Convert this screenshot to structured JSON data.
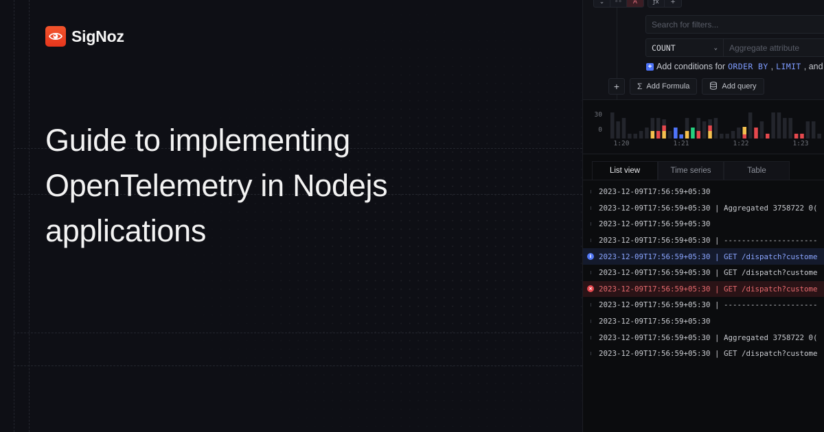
{
  "brand": {
    "name": "SigNoz",
    "accent": "#EB3F22",
    "logo_icon": "eye-icon"
  },
  "hero": {
    "title_lines": [
      "Guide to implementing",
      "OpenTelemetry in Nodejs",
      "applications"
    ]
  },
  "query_builder": {
    "toolbar_left": [
      {
        "icon": "chevron-down-icon",
        "glyph": "⌄"
      },
      {
        "icon": "visibility-icon",
        "glyph": "◦◦"
      },
      {
        "icon": "query-label",
        "glyph": "A",
        "active": true
      }
    ],
    "toolbar_right": [
      {
        "icon": "function-icon",
        "glyph": "ƒx"
      },
      {
        "icon": "plus-icon",
        "glyph": "+"
      }
    ],
    "filter_placeholder": "Search for filters...",
    "aggregate": {
      "selected": "COUNT",
      "attribute_placeholder": "Aggregate attribute"
    },
    "conditions": {
      "prefix": "Add conditions for",
      "keywords": [
        "ORDER BY",
        "LIMIT"
      ],
      "separator": ",",
      "suffix": ", and"
    },
    "actions": {
      "add": "+",
      "add_formula": "Add Formula",
      "add_query": "Add query"
    }
  },
  "chart_data": {
    "type": "bar",
    "title": "",
    "xlabel": "",
    "ylabel": "",
    "y_ticks": [
      "30",
      "0"
    ],
    "x_ticks": [
      "1:20",
      "1:21",
      "1:22",
      "1:23"
    ],
    "colors": {
      "base": "#23252c",
      "yellow": "#f5c04e",
      "red": "#e5484d",
      "blue": "#4e74f8",
      "green": "#25d07f"
    },
    "bars": [
      {
        "total": 38,
        "segments": []
      },
      {
        "total": 25,
        "segments": []
      },
      {
        "total": 30,
        "segments": []
      },
      {
        "total": 7,
        "segments": []
      },
      {
        "total": 7,
        "segments": []
      },
      {
        "total": 11,
        "segments": []
      },
      {
        "total": 16,
        "segments": []
      },
      {
        "total": 30,
        "segments": [
          {
            "color": "yellow",
            "value": 11
          }
        ]
      },
      {
        "total": 30,
        "segments": [
          {
            "color": "red",
            "value": 11
          }
        ]
      },
      {
        "total": 28,
        "segments": [
          {
            "color": "yellow",
            "value": 11
          },
          {
            "color": "red",
            "value": 8
          }
        ]
      },
      {
        "total": 11,
        "segments": []
      },
      {
        "total": 16,
        "segments": [
          {
            "color": "blue",
            "value": 16
          }
        ]
      },
      {
        "total": 6,
        "segments": [
          {
            "color": "blue",
            "value": 6
          }
        ]
      },
      {
        "total": 30,
        "segments": [
          {
            "color": "yellow",
            "value": 11
          }
        ]
      },
      {
        "total": 16,
        "segments": [
          {
            "color": "green",
            "value": 16
          }
        ]
      },
      {
        "total": 30,
        "segments": [
          {
            "color": "red",
            "value": 11
          }
        ]
      },
      {
        "total": 25,
        "segments": []
      },
      {
        "total": 28,
        "segments": [
          {
            "color": "yellow",
            "value": 11
          },
          {
            "color": "red",
            "value": 8
          }
        ]
      },
      {
        "total": 30,
        "segments": []
      },
      {
        "total": 7,
        "segments": []
      },
      {
        "total": 7,
        "segments": []
      },
      {
        "total": 11,
        "segments": []
      },
      {
        "total": 16,
        "segments": []
      },
      {
        "total": 17,
        "segments": [
          {
            "color": "red",
            "value": 6
          },
          {
            "color": "yellow",
            "value": 11
          }
        ]
      },
      {
        "total": 38,
        "segments": []
      },
      {
        "total": 16,
        "segments": [
          {
            "color": "red",
            "value": 16
          }
        ]
      },
      {
        "total": 25,
        "segments": []
      },
      {
        "total": 7,
        "segments": [
          {
            "color": "red",
            "value": 7
          }
        ]
      },
      {
        "total": 38,
        "segments": []
      },
      {
        "total": 38,
        "segments": []
      },
      {
        "total": 30,
        "segments": []
      },
      {
        "total": 30,
        "segments": []
      },
      {
        "total": 7,
        "segments": [
          {
            "color": "red",
            "value": 7
          }
        ]
      },
      {
        "total": 7,
        "segments": [
          {
            "color": "red",
            "value": 7
          }
        ]
      },
      {
        "total": 25,
        "segments": []
      },
      {
        "total": 25,
        "segments": []
      },
      {
        "total": 7,
        "segments": []
      }
    ],
    "ylim": [
      0,
      40
    ],
    "grid": false
  },
  "tabs": [
    {
      "label": "List view",
      "active": true
    },
    {
      "label": "Time series",
      "active": false
    },
    {
      "label": "Table",
      "active": false
    }
  ],
  "logs": [
    {
      "level": "default",
      "text": "2023-12-09T17:56:59+05:30"
    },
    {
      "level": "default",
      "text": "2023-12-09T17:56:59+05:30 | Aggregated 3758722 0("
    },
    {
      "level": "default",
      "text": "2023-12-09T17:56:59+05:30"
    },
    {
      "level": "default",
      "text": "2023-12-09T17:56:59+05:30 | ---------------------"
    },
    {
      "level": "info",
      "text": "2023-12-09T17:56:59+05:30 | GET /dispatch?custome"
    },
    {
      "level": "default",
      "text": "2023-12-09T17:56:59+05:30 | GET /dispatch?custome"
    },
    {
      "level": "error",
      "text": "2023-12-09T17:56:59+05:30 | GET /dispatch?custome"
    },
    {
      "level": "default",
      "text": "2023-12-09T17:56:59+05:30 | ---------------------"
    },
    {
      "level": "default",
      "text": "2023-12-09T17:56:59+05:30"
    },
    {
      "level": "default",
      "text": "2023-12-09T17:56:59+05:30 | Aggregated 3758722 0("
    },
    {
      "level": "default",
      "text": "2023-12-09T17:56:59+05:30 | GET /dispatch?custome"
    }
  ]
}
